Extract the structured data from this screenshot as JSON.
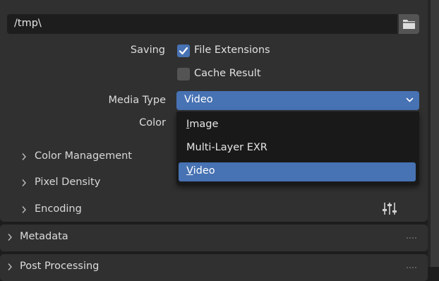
{
  "output": {
    "path_value": "/tmp\\",
    "saving_label": "Saving",
    "file_extensions_label": "File Extensions",
    "file_extensions_checked": true,
    "cache_result_label": "Cache Result",
    "cache_result_checked": false,
    "media_type_label": "Media Type",
    "media_type_value": "Video",
    "color_label": "Color"
  },
  "media_type_menu": {
    "options": [
      {
        "label": "Image",
        "mnemonic": "I",
        "rest": "mage",
        "selected": false
      },
      {
        "label": "Multi-Layer EXR",
        "selected": false
      },
      {
        "label": "Video",
        "mnemonic": "V",
        "rest": "ideo",
        "selected": true
      }
    ]
  },
  "subpanels": [
    {
      "label": "Color Management"
    },
    {
      "label": "Pixel Density"
    },
    {
      "label": "Encoding"
    }
  ],
  "sections": [
    {
      "label": "Metadata"
    },
    {
      "label": "Post Processing"
    }
  ],
  "icons": {
    "folder": "folder-icon",
    "checkmark": "checkmark-icon",
    "dropdown_arrow": "chevron-down-icon",
    "subpanel_arrow": "chevron-right-icon",
    "presets": "presets-sliders-icon",
    "grip": "drag-grip-icon"
  },
  "colors": {
    "accent": "#4772b3",
    "panel": "#303030",
    "field": "#1d1d1d",
    "menu": "#191919"
  }
}
